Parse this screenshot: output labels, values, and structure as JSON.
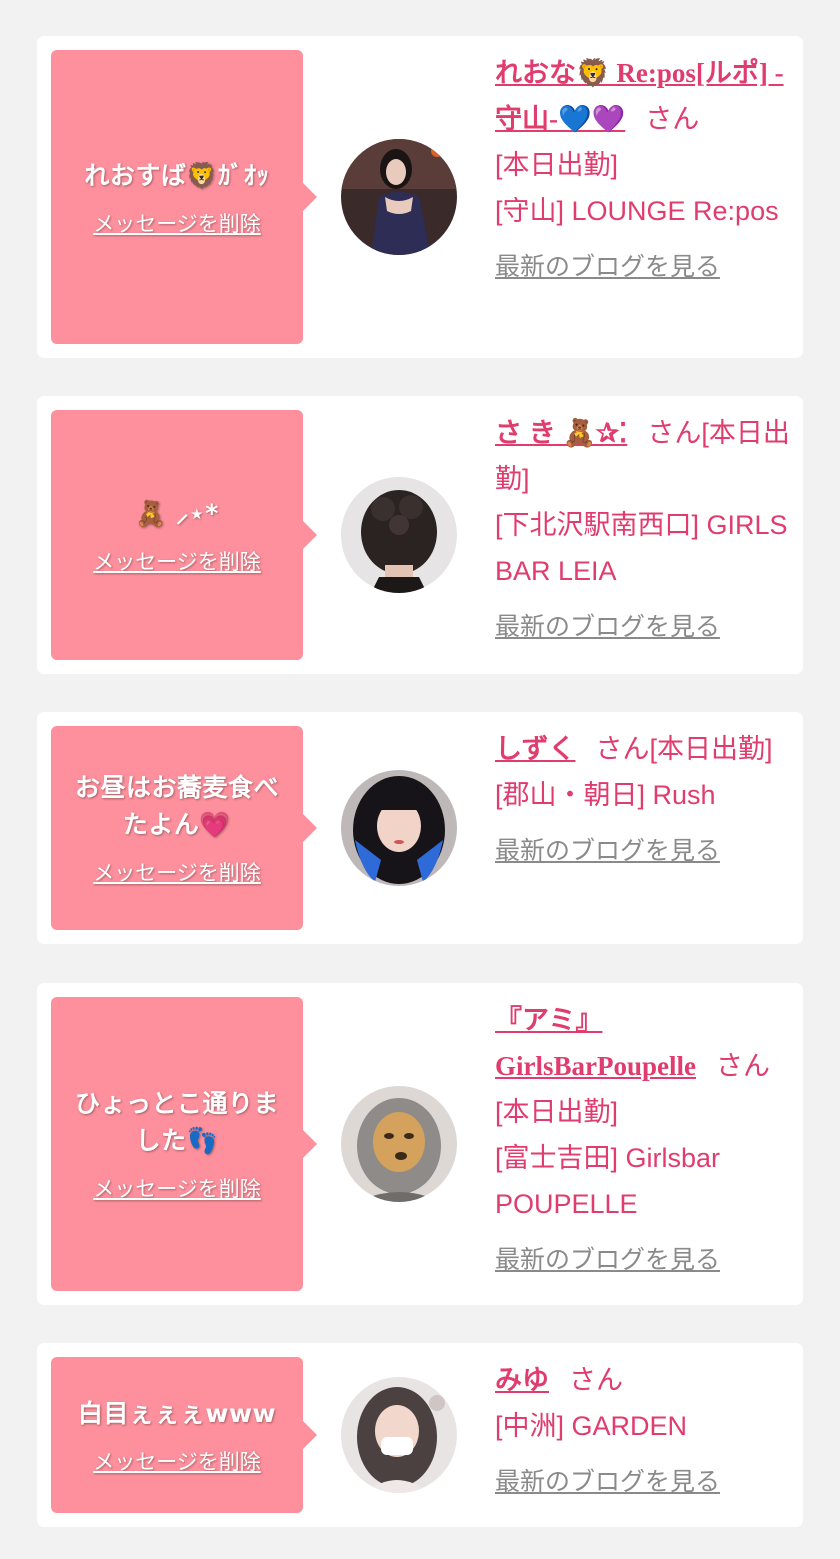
{
  "cards": [
    {
      "message": "れおすば🦁ｶﾞｵｯ",
      "delete_label": "メッセージを削除",
      "name": "れおな🦁 Re:pos[ルポ] -守山-💙💜",
      "honorific": "さん",
      "status": "[本日出勤]",
      "shop": "[守山] LOUNGE Re:pos",
      "blog_label": "最新のブログを見る"
    },
    {
      "message": "🧸 ⸝⋆*",
      "delete_label": "メッセージを削除",
      "name": "さ き 🧸✰⁚",
      "honorific": "さん",
      "status": "[本日出勤]",
      "shop": "[下北沢駅南西口] GIRLS BAR LEIA",
      "blog_label": "最新のブログを見る"
    },
    {
      "message": "お昼はお蕎麦食べたよん💗",
      "delete_label": "メッセージを削除",
      "name": "しずく",
      "honorific": "さん",
      "status": "[本日出勤]",
      "shop": "[郡山・朝日] Rush",
      "blog_label": "最新のブログを見る"
    },
    {
      "message": "ひょっとこ通りました👣",
      "delete_label": "メッセージを削除",
      "name": "『アミ』GirlsBarPoupelle",
      "honorific": "さん",
      "status": "[本日出勤]",
      "shop": "[富士吉田] Girlsbar POUPELLE",
      "blog_label": "最新のブログを見る"
    },
    {
      "message": "白目ぇぇぇwww",
      "delete_label": "メッセージを削除",
      "name": "みゆ",
      "honorific": "さん",
      "status": "",
      "shop": "[中洲] GARDEN",
      "blog_label": "最新のブログを見る"
    }
  ],
  "colors": {
    "page_bg": "#f2f2f2",
    "card_bg": "#ffffff",
    "bubble_bg": "#fd909c",
    "accent_text": "#e03c6e",
    "link_gray": "#8a8a8a"
  }
}
